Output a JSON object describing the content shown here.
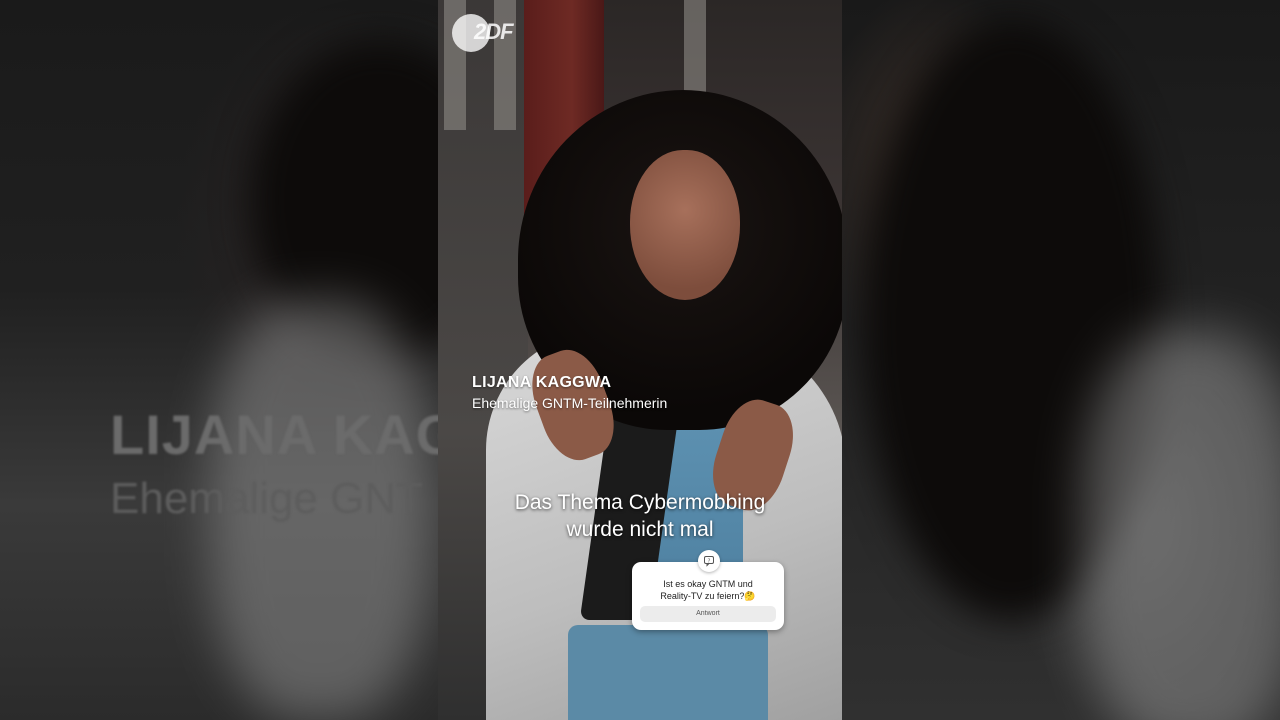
{
  "channel": {
    "logo_text": "2DF"
  },
  "lower_third": {
    "name": "LIJANA KAGGWA",
    "role": "Ehemalige GNTM-Teilnehmerin"
  },
  "subtitles": {
    "line1": "Das Thema Cybermobbing",
    "line2": "wurde nicht mal"
  },
  "question_sticker": {
    "icon": "question-bubble-icon",
    "line1": "Ist es okay GNTM und",
    "line2": "Reality-TV zu feiern?🤔",
    "answer_label": "Antwort"
  },
  "background_blur": {
    "title": "LIJANA KAG",
    "subtitle": "Ehemalige GNT"
  },
  "colors": {
    "background": "#141414",
    "text": "#ffffff",
    "sticker": "#ffffff"
  }
}
